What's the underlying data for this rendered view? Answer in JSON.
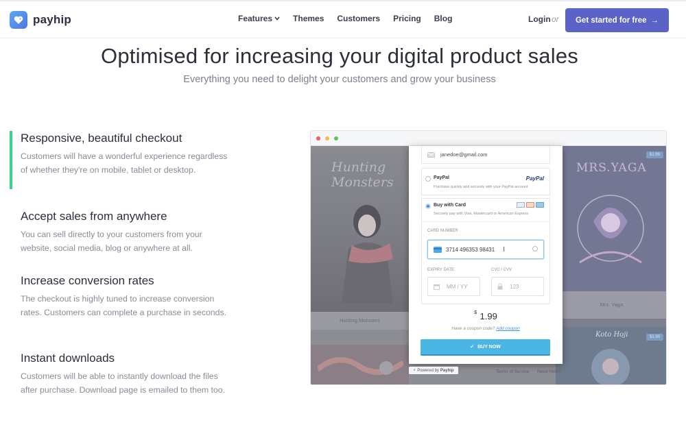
{
  "brand": {
    "name": "payhip"
  },
  "nav": {
    "items": [
      {
        "label": "Features",
        "has_dropdown": true
      },
      {
        "label": "Themes"
      },
      {
        "label": "Customers"
      },
      {
        "label": "Pricing"
      },
      {
        "label": "Blog"
      }
    ],
    "login": "Login",
    "or": "or",
    "cta": "Get started for free",
    "cta_arrow": "→"
  },
  "hero": {
    "title": "Optimised for increasing your digital product sales",
    "subtitle": "Everything you need to delight your customers and grow your business"
  },
  "features": [
    {
      "title": "Responsive, beautiful checkout",
      "body": "Customers will have a wonderful experience regardless of whether they're on mobile, tablet or desktop.",
      "active": true
    },
    {
      "title": "Accept sales from anywhere",
      "body": "You can sell directly to your customers from your website, social media, blog or anywhere at all."
    },
    {
      "title": "Increase conversion rates",
      "body": "The checkout is highly tuned to increase conversion rates. Customers can complete a purchase in seconds."
    },
    {
      "title": "Instant downloads",
      "body": "Customers will be able to instantly download the files after purchase. Download page is emailed to them too."
    }
  ],
  "mockup": {
    "products": [
      {
        "cover_title": "Hunting Monsters",
        "caption": "Hunting Monsters"
      },
      {
        "cover_title": "MRS.YAGA",
        "caption": "Mrs. Yaga",
        "price": "$1.99"
      },
      {
        "cover_title": "Koto Hoji",
        "price": "$1.99"
      }
    ],
    "checkout": {
      "email": "janedoe@gmail.com",
      "paypal": {
        "label": "PayPal",
        "desc": "Purchase quickly and securely with your PayPal account",
        "logo": "PayPal"
      },
      "card": {
        "label": "Buy with Card",
        "desc": "Securely pay with Visa, Mastercard or American Express"
      },
      "card_number_label": "CARD NUMBER",
      "card_number_value": "3714 496353 98431",
      "expiry_label": "EXPIRY DATE",
      "expiry_placeholder": "MM / YY",
      "cvc_label": "CVC / CVV",
      "cvc_placeholder": "123",
      "currency": "$",
      "price": "1.99",
      "coupon_prompt": "Have a coupon code?",
      "coupon_link": "Add coupon",
      "buy_label": "BUY NOW",
      "powered_prefix": "Powered by",
      "powered_brand": "Payhip",
      "terms": "Terms of Service",
      "help": "Need Help?"
    }
  },
  "colors": {
    "accent": "#5b63c9",
    "active_bar": "#3ccf8e",
    "buy_button": "#4bb6e6"
  }
}
